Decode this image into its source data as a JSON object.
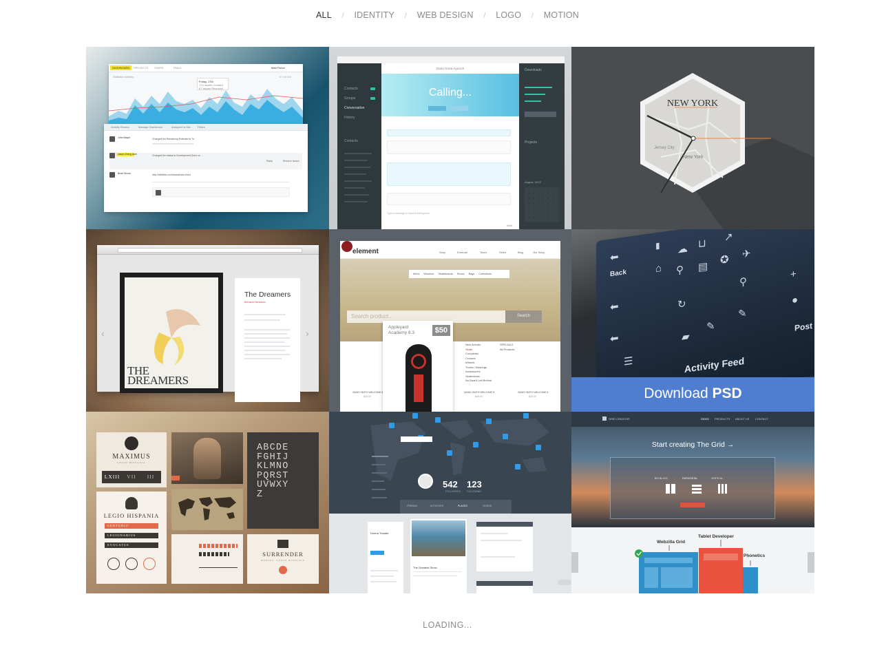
{
  "filters": {
    "items": [
      {
        "label": "ALL",
        "active": true
      },
      {
        "label": "IDENTITY",
        "active": false
      },
      {
        "label": "WEB DESIGN",
        "active": false
      },
      {
        "label": "LOGO",
        "active": false
      },
      {
        "label": "MOTION",
        "active": false
      }
    ],
    "separator": "/"
  },
  "tiles": {
    "dashboard": {
      "tabs": [
        "DASHBOARD",
        "PROJECTS",
        "SHARE",
        "EMAIL"
      ],
      "user": "Matt Fisher",
      "tooltip_date": "Friday, 17th",
      "tooltip_line1": "174 Issues Created",
      "tooltip_line2": "67 Issues Resolved",
      "statistics": "Statistics Weekly",
      "time": "07:45 AM",
      "panel_tabs": [
        "Activity Stream",
        "Manage Dashboard",
        "Assigned to Me",
        "Filters"
      ],
      "rows": [
        {
          "name": "John Mayer",
          "text": "Changed the Remaining Estimate to 7d"
        },
        {
          "name": "Jason Zheng Alan",
          "text": "Changed the status to Development Done on ..."
        },
        {
          "name": "Brian Moore",
          "text": "http://dribbble.com/brasa/have-fixed"
        }
      ],
      "reply": "Reply",
      "resolve": "Resolve Issues"
    },
    "calling": {
      "title": "Calling...",
      "contact": "Dana Greta Agovich",
      "sidebar": [
        "Contacts",
        "Groups",
        "Conversation",
        "History"
      ],
      "sidebar_contacts": "Contacts",
      "downloads": "Downloads",
      "projects": "Projects",
      "calendar": "August, 2013",
      "compose_placeholder": "Type a message to Dana Greta Agovich",
      "send": "Send"
    },
    "clock": {
      "city": "NEW YORK",
      "map_label_1": "Jersey City",
      "map_label_2": "New York"
    },
    "dreamers": {
      "poster_title_1": "THE",
      "poster_title_2": "DREAMERS",
      "card_title": "The Dreamers",
      "card_subtitle": "Bernardo Bertolucci"
    },
    "shop": {
      "logo": "element",
      "nav": [
        "Shop",
        "Emerald",
        "Team",
        "Video",
        "Blog",
        "Our Story"
      ],
      "subnav": [
        "Mens",
        "Womens",
        "Skateboards",
        "Shoes",
        "Bags",
        "Collections"
      ],
      "search_placeholder": "Search product...",
      "search_button": "Search",
      "product_name_1": "Appleyard",
      "product_name_2": "Academy 8.3",
      "price": "$50",
      "categories": [
        "New Arrivals",
        "Skate",
        "Completes",
        "Cruisers",
        "Wheels",
        "Trucks / Bearings",
        "Accessories",
        "Skatedecks",
        "No Board Left Behind"
      ],
      "specials": [
        "SPECIALS",
        "All Products"
      ],
      "footer_items": [
        "ZANDI SMITH WELCOME 8",
        "ZANDI SMITH WELCOME 8",
        "ZANDI SMITH WELCOME 8"
      ],
      "footer_price": "$45.00"
    },
    "iphone": {
      "back": "Back",
      "activity": "Activity Feed",
      "post": "Post"
    },
    "map": {
      "followers": "542",
      "following": "123",
      "followers_label": "FOLLOWERS",
      "following_label": "FOLLOWING",
      "tabs": [
        "FRIENDS",
        "ACTIVITIES",
        "PLACES",
        "VIDEOS"
      ]
    },
    "social": {
      "name": "Donna Treader",
      "caption": "The Greatest Show"
    },
    "download": {
      "prefix": "Download",
      "bold": "PSD"
    },
    "grid_creator": {
      "brand": "GRID CREATOR",
      "nav": [
        "DEMO",
        "PRODUCTS",
        "ABOUT US",
        "CONTACT"
      ],
      "cta": "Start creating The Grid →",
      "toggles": [
        "BIG BLOCK",
        "HORIZONTAL",
        "VERTICAL"
      ]
    },
    "responsive": {
      "tablet": "Tablet Developer",
      "webzilla": "Webzilla Grid",
      "phone": "Phonetics"
    },
    "legio": {
      "maximus": "MAXIMUS",
      "maximus_sub": "LEGIO HISPANIA",
      "numerals": [
        "LXIII",
        "VII",
        "III"
      ],
      "legio": "LEGIO HISPANIA",
      "ranks": [
        "CENTURIO",
        "LEGIONARIUS",
        "EVOCATUS"
      ],
      "alphabet": [
        "ABCDE",
        "FGHIJ",
        "KLMNO",
        "PQRST",
        "UVWXY",
        "Z"
      ],
      "surrender": "SURRENDER",
      "surrender_sub": "BODIES: LEGIO HISPANIA"
    }
  },
  "loading": "LOADING..."
}
